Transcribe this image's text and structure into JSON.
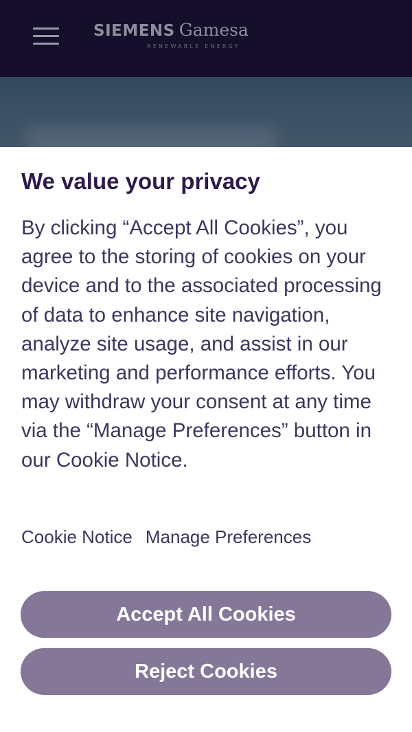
{
  "header": {
    "menu_icon": "hamburger-menu-icon",
    "logo": {
      "brand": "SIEMENS",
      "sub": "Gamesa",
      "tagline": "RENEWABLE ENERGY"
    }
  },
  "consent": {
    "title": "We value your privacy",
    "body": "By clicking “Accept All Cookies”, you agree to the storing of cookies on your device and to the associated processing of data to enhance site navigation, analyze site usage, and assist in our marketing and performance efforts. You may withdraw your consent at any time via the “Manage Preferences” button in our Cookie Notice.",
    "links": {
      "cookie_notice": "Cookie Notice",
      "manage_preferences": "Manage Preferences"
    },
    "buttons": {
      "accept_all": "Accept All Cookies",
      "reject": "Reject Cookies"
    }
  },
  "colors": {
    "header_bg": "#150f2b",
    "title": "#2d1a4a",
    "body_text": "#3f355c",
    "button_bg": "#847798",
    "button_text": "#ffffff"
  }
}
